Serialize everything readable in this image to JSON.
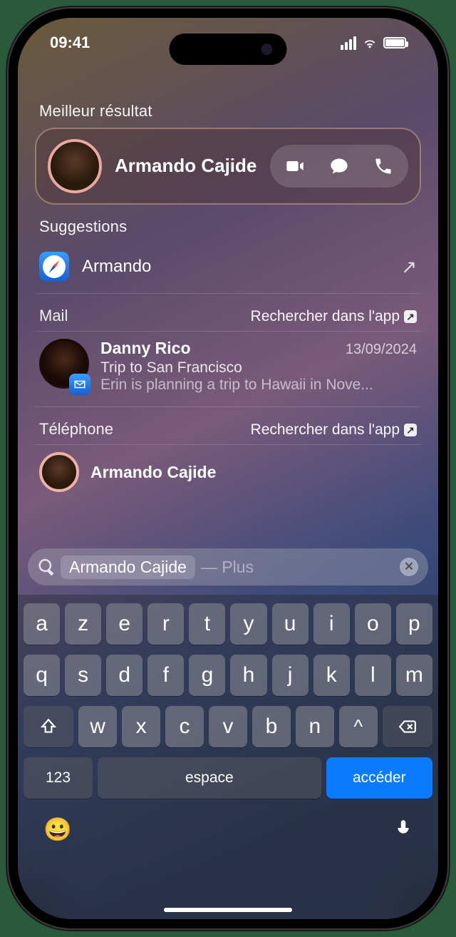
{
  "statusbar": {
    "time": "09:41"
  },
  "sections": {
    "best": {
      "label": "Meilleur résultat",
      "name": "Armando Cajide"
    },
    "suggestions": {
      "label": "Suggestions",
      "items": [
        {
          "label": "Armando"
        }
      ]
    },
    "mail": {
      "label": "Mail",
      "search_link": "Rechercher dans l'app",
      "items": [
        {
          "from": "Danny Rico",
          "date": "13/09/2024",
          "subject": "Trip to San Francisco",
          "preview": "Erin is planning a trip to Hawaii in Nove..."
        }
      ]
    },
    "phone": {
      "label": "Téléphone",
      "search_link": "Rechercher dans l'app",
      "items": [
        {
          "name": "Armando Cajide"
        }
      ]
    }
  },
  "search": {
    "chip": "Armando Cajide",
    "suffix": " — Plus"
  },
  "keyboard": {
    "row1": [
      "a",
      "z",
      "e",
      "r",
      "t",
      "y",
      "u",
      "i",
      "o",
      "p"
    ],
    "row2": [
      "q",
      "s",
      "d",
      "f",
      "g",
      "h",
      "j",
      "k",
      "l",
      "m"
    ],
    "row3": [
      "w",
      "x",
      "c",
      "v",
      "b",
      "n",
      "^"
    ],
    "num": "123",
    "space": "espace",
    "go": "accéder"
  }
}
